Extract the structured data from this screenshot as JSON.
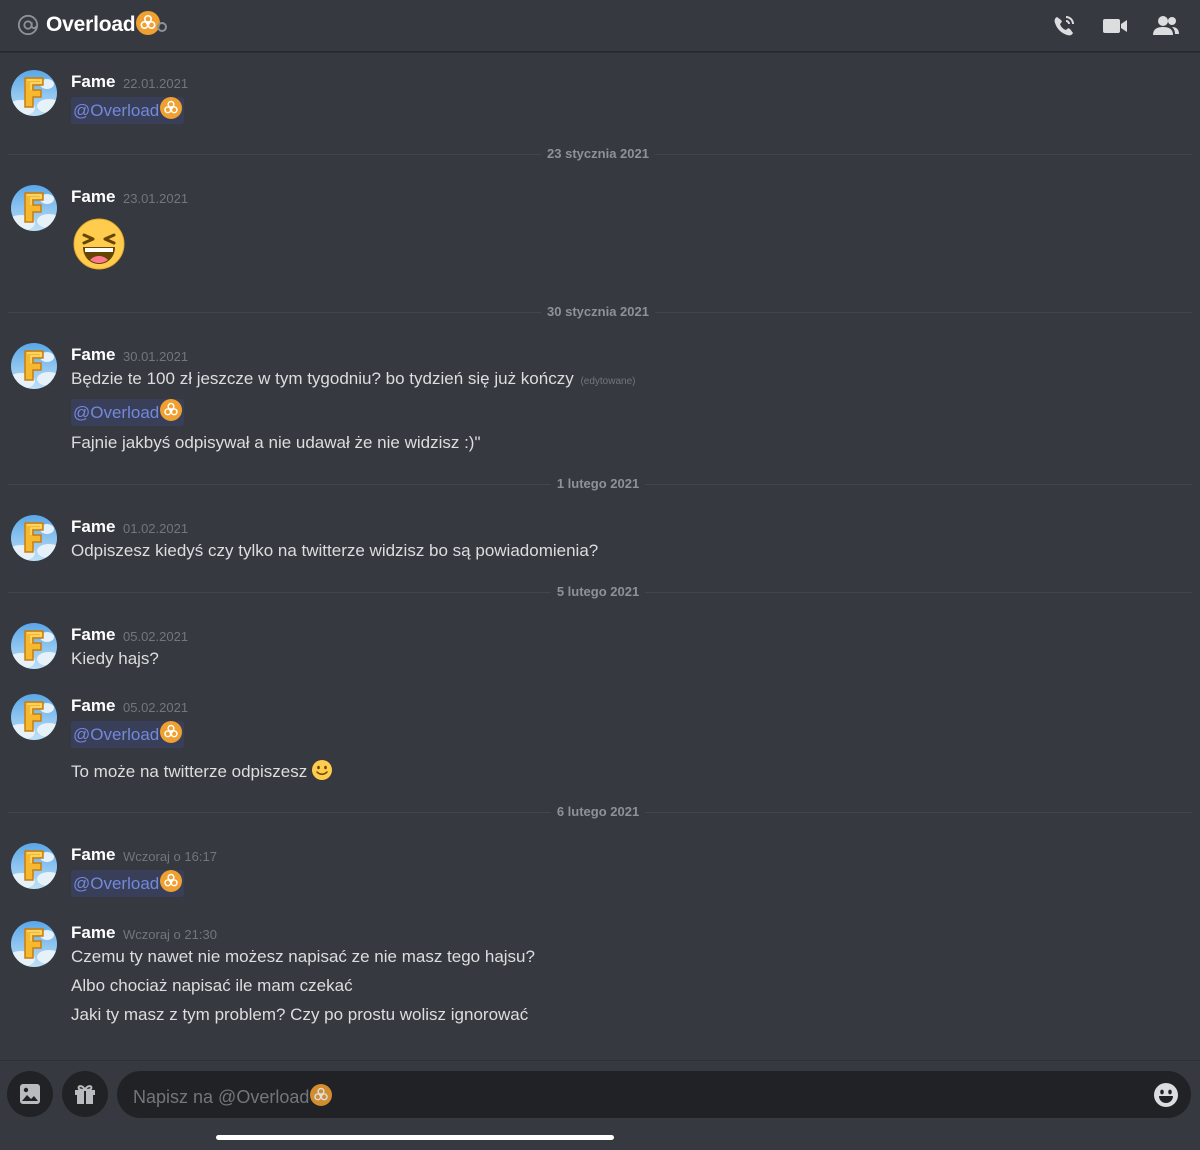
{
  "header": {
    "title": "Overload",
    "icons": [
      "at-icon",
      "biohazard-icon",
      "status-dot",
      "phone-call-icon",
      "video-call-icon",
      "members-icon"
    ]
  },
  "messages": [
    {
      "author": "Fame",
      "timestamp": "22.01.2021",
      "mention": "@Overload"
    },
    {
      "divider": "23 stycznia 2021"
    },
    {
      "author": "Fame",
      "timestamp": "23.01.2021",
      "emoji": "laughing-emoji"
    },
    {
      "divider": "30 stycznia 2021"
    },
    {
      "author": "Fame",
      "timestamp": "30.01.2021",
      "text": "Będzie te 100 zł jeszcze w tym tygodniu? bo tydzień się już kończy",
      "edited": "(edytowane)",
      "mention": "@Overload",
      "text2": "Fajnie jakbyś odpisywał a nie udawał  że nie widzisz :)\""
    },
    {
      "divider": "1 lutego 2021"
    },
    {
      "author": "Fame",
      "timestamp": "01.02.2021",
      "text": "Odpiszesz kiedyś czy tylko na twitterze widzisz bo są powiadomienia?"
    },
    {
      "divider": "5 lutego 2021"
    },
    {
      "author": "Fame",
      "timestamp": "05.02.2021",
      "text": "Kiedy hajs?"
    },
    {
      "author": "Fame",
      "timestamp": "05.02.2021",
      "mention": "@Overload",
      "text": "To może na twitterze odpiszesz"
    },
    {
      "divider": "6 lutego 2021"
    },
    {
      "author": "Fame",
      "timestamp": "Wczoraj o 16:17",
      "mention": "@Overload"
    },
    {
      "author": "Fame",
      "timestamp": "Wczoraj o 21:30",
      "lines": [
        "Czemu ty nawet nie możesz napisać ze nie masz tego hajsu?",
        "Albo chociaż napisać ile mam czekać",
        "Jaki ty masz z tym problem? Czy po prostu wolisz ignorować"
      ]
    }
  ],
  "composer": {
    "placeholder": "Napisz na @Overload",
    "icons": [
      "image-icon",
      "gift-icon",
      "emoji-icon"
    ]
  },
  "colors": {
    "background": "#36393f",
    "mention": "#7289da",
    "input": "#202225",
    "biohazard": "#f0a030"
  }
}
